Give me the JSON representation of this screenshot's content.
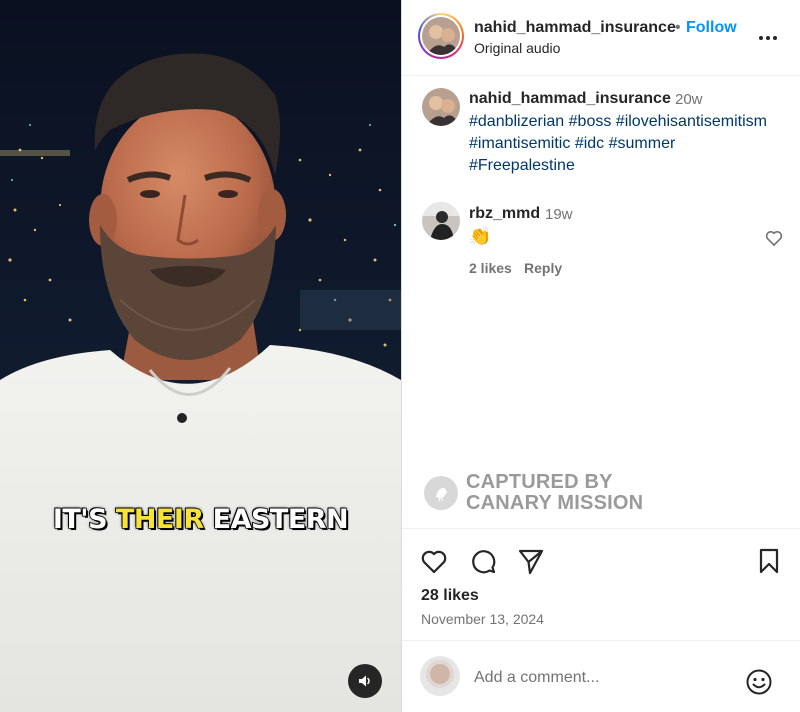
{
  "video": {
    "caption_parts": [
      "IT'S ",
      "THEIR",
      " EASTERN"
    ],
    "audio_icon": "speaker-icon"
  },
  "header": {
    "username": "nahid_hammad_insurance",
    "separator": "•",
    "follow_label": "Follow",
    "audio_label": "Original audio",
    "more_icon": "more-options-icon"
  },
  "caption": {
    "username": "nahid_hammad_insurance",
    "time": "20w",
    "hashtags": [
      "#danblizerian",
      "#boss",
      "#ilovehisantisemitism",
      "#imantisemitic",
      "#idc",
      "#summer",
      "#Freepalestine"
    ]
  },
  "comments": [
    {
      "username": "rbz_mmd",
      "time": "19w",
      "text": "👏",
      "likes_label": "2 likes",
      "reply_label": "Reply"
    }
  ],
  "watermark": {
    "line1": "CAPTURED BY",
    "line2": "CANARY MISSION"
  },
  "actions": {
    "likes": "28 likes",
    "date": "November 13, 2024"
  },
  "add_comment": {
    "placeholder": "Add a comment..."
  },
  "colors": {
    "accent": "#0095f6",
    "hashtag": "#00376b",
    "secondary_text": "#737373",
    "caption_highlight": "#f7e23a"
  }
}
